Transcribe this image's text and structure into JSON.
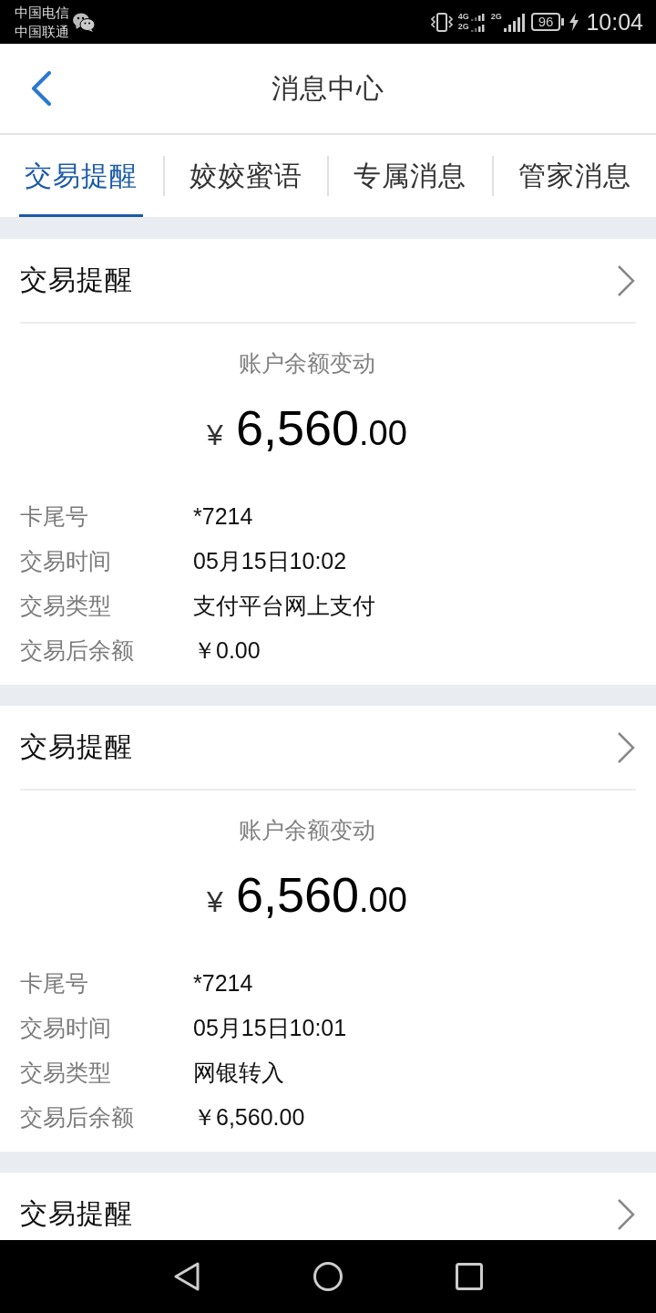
{
  "status_bar": {
    "carriers": [
      "中国电信",
      "中国联通"
    ],
    "sim_signals": [
      {
        "types": [
          "4G",
          "2G"
        ]
      },
      {
        "types": [
          "2G"
        ]
      }
    ],
    "battery": "96",
    "charging": true,
    "time": "10:04"
  },
  "header": {
    "title": "消息中心"
  },
  "tabs": [
    {
      "label": "交易提醒",
      "selected": true
    },
    {
      "label": "姣姣蜜语",
      "selected": false
    },
    {
      "label": "专属消息",
      "selected": false
    },
    {
      "label": "管家消息",
      "selected": false
    }
  ],
  "messages": [
    {
      "title": "交易提醒",
      "subtitle": "账户余额变动",
      "currency": "¥",
      "amount": "6,560.00",
      "details": [
        {
          "label": "卡尾号",
          "value": "*7214"
        },
        {
          "label": "交易时间",
          "value": "05月15日10:02"
        },
        {
          "label": "交易类型",
          "value": "支付平台网上支付"
        },
        {
          "label": "交易后余额",
          "value": "￥0.00"
        }
      ]
    },
    {
      "title": "交易提醒",
      "subtitle": "账户余额变动",
      "currency": "¥",
      "amount": "6,560.00",
      "details": [
        {
          "label": "卡尾号",
          "value": "*7214"
        },
        {
          "label": "交易时间",
          "value": "05月15日10:01"
        },
        {
          "label": "交易类型",
          "value": "网银转入"
        },
        {
          "label": "交易后余额",
          "value": "￥6,560.00"
        }
      ]
    },
    {
      "title": "交易提醒"
    }
  ]
}
